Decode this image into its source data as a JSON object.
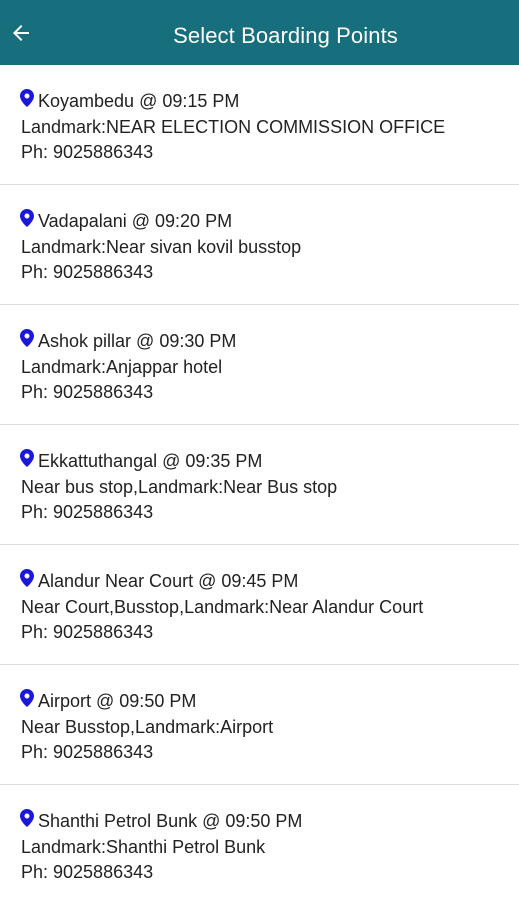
{
  "header": {
    "title": "Select Boarding Points",
    "back_icon": "arrow-left-icon",
    "background": "#176e7c"
  },
  "boarding_points": [
    {
      "name": "Koyambedu @ 09:15 PM",
      "landmark": "Landmark:NEAR ELECTION COMMISSION OFFICE",
      "phone": "Ph: 9025886343"
    },
    {
      "name": "Vadapalani @ 09:20 PM",
      "landmark": "Landmark:Near sivan kovil busstop",
      "phone": "Ph: 9025886343"
    },
    {
      "name": "Ashok pillar @ 09:30 PM",
      "landmark": "Landmark:Anjappar hotel",
      "phone": "Ph: 9025886343"
    },
    {
      "name": "Ekkattuthangal @ 09:35 PM",
      "landmark": "Near bus stop,Landmark:Near Bus stop",
      "phone": "Ph: 9025886343"
    },
    {
      "name": "Alandur Near Court @ 09:45 PM",
      "landmark": "Near Court,Busstop,Landmark:Near Alandur Court",
      "phone": "Ph: 9025886343"
    },
    {
      "name": "Airport @ 09:50 PM",
      "landmark": "Near Busstop,Landmark:Airport",
      "phone": "Ph: 9025886343"
    },
    {
      "name": "Shanthi Petrol Bunk @ 09:50 PM",
      "landmark": "Landmark:Shanthi Petrol Bunk",
      "phone": "Ph: 9025886343"
    }
  ],
  "pin_icon": "location-pin-icon",
  "pin_color": "#1a1ad6"
}
